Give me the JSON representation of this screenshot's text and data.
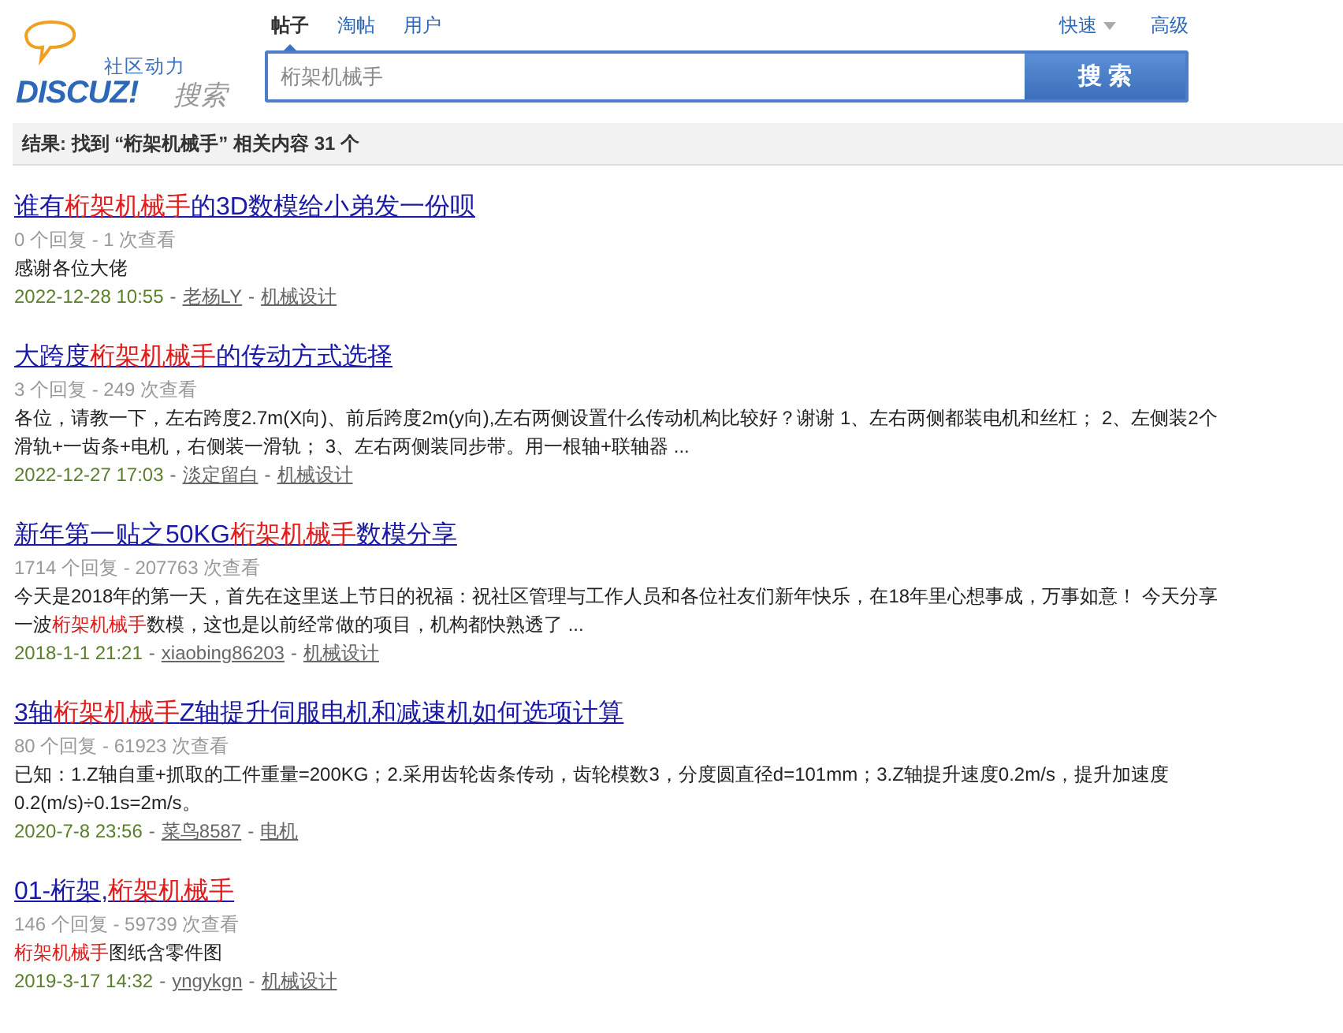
{
  "logo": {
    "tagline": "社区动力",
    "brand": "DISCUZ!",
    "suffix": "搜索"
  },
  "tabs": [
    {
      "label": "帖子",
      "selected": true
    },
    {
      "label": "淘帖",
      "selected": false
    },
    {
      "label": "用户",
      "selected": false
    }
  ],
  "options": {
    "quick": "快速",
    "advanced": "高级"
  },
  "search": {
    "value": "桁架机械手",
    "button": "搜 索"
  },
  "summary": "结果: 找到 “桁架机械手” 相关内容 31 个",
  "results": [
    {
      "title": [
        {
          "text": "谁有",
          "hl": false
        },
        {
          "text": "桁架机械手",
          "hl": true
        },
        {
          "text": "的3D数模给小弟发一份呗",
          "hl": false
        }
      ],
      "stats": "0 个回复 - 1 次查看",
      "snippet": [
        {
          "text": "感谢各位大佬",
          "hl": false
        }
      ],
      "date": "2022-12-28 10:55",
      "separators": [
        "-",
        "-"
      ],
      "author": "老杨LY",
      "forum": "机械设计"
    },
    {
      "title": [
        {
          "text": "大跨度",
          "hl": false
        },
        {
          "text": "桁架机械手",
          "hl": true
        },
        {
          "text": "的传动方式选择",
          "hl": false
        }
      ],
      "stats": "3 个回复 - 249 次查看",
      "snippet": [
        {
          "text": "各位，请教一下，左右跨度2.7m(X向)、前后跨度2m(y向),左右两侧设置什么传动机构比较好？谢谢 1、左右两侧都装电机和丝杠； 2、左侧装2个滑轨+一齿条+电机，右侧装一滑轨； 3、左右两侧装同步带。用一根轴+联轴器 ...",
          "hl": false
        }
      ],
      "date": "2022-12-27 17:03",
      "separators": [
        "-",
        "-"
      ],
      "author": "淡定留白",
      "forum": "机械设计"
    },
    {
      "title": [
        {
          "text": "新年第一贴之50KG",
          "hl": false
        },
        {
          "text": "桁架机械手",
          "hl": true
        },
        {
          "text": "数模分享",
          "hl": false
        }
      ],
      "stats": "1714 个回复 - 207763 次查看",
      "snippet": [
        {
          "text": "今天是2018年的第一天，首先在这里送上节日的祝福：祝社区管理与工作人员和各位社友们新年快乐，在18年里心想事成，万事如意！ 今天分享一波",
          "hl": false
        },
        {
          "text": "桁架机械手",
          "hl": true
        },
        {
          "text": "数模，这也是以前经常做的项目，机构都快熟透了 ...",
          "hl": false
        }
      ],
      "date": "2018-1-1 21:21",
      "separators": [
        "-",
        "-"
      ],
      "author": "xiaobing86203",
      "forum": "机械设计"
    },
    {
      "title": [
        {
          "text": "3轴",
          "hl": false
        },
        {
          "text": "桁架机械手",
          "hl": true
        },
        {
          "text": "Z轴提升伺服电机和减速机如何选项计算",
          "hl": false
        }
      ],
      "stats": "80 个回复 - 61923 次查看",
      "snippet": [
        {
          "text": "已知：1.Z轴自重+抓取的工件重量=200KG；2.采用齿轮齿条传动，齿轮模数3，分度圆直径d=101mm；3.Z轴提升速度0.2m/s，提升加速度0.2(m/s)÷0.1s=2m/s。",
          "hl": false
        }
      ],
      "date": "2020-7-8 23:56",
      "separators": [
        "-",
        "-"
      ],
      "author": "菜鸟8587",
      "forum": "电机"
    },
    {
      "title": [
        {
          "text": "01-桁架,",
          "hl": false
        },
        {
          "text": "桁架机械手",
          "hl": true
        }
      ],
      "stats": "146 个回复 - 59739 次查看",
      "snippet": [
        {
          "text": "桁架机械手",
          "hl": true
        },
        {
          "text": "图纸含零件图",
          "hl": false
        }
      ],
      "date": "2019-3-17 14:32",
      "separators": [
        "-",
        "-"
      ],
      "author": "yngykgn",
      "forum": "机械设计"
    }
  ]
}
